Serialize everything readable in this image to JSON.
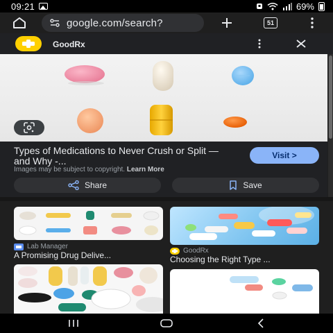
{
  "status_bar": {
    "time": "09:21",
    "battery": "69%"
  },
  "browser": {
    "url": "google.com/search?",
    "tab_count": "51"
  },
  "source": {
    "name": "GoodRx"
  },
  "result": {
    "title": "Types of Medications to Never Crush or Split — and Why -...",
    "copyright_text": "Images may be subject to copyright.",
    "learn_more": "Learn More",
    "visit_label": "Visit >",
    "share_label": "Share",
    "save_label": "Save"
  },
  "related": [
    {
      "source": "Lab Manager",
      "title": "A Promising Drug Delive..."
    },
    {
      "source": "GoodRx",
      "title": "Choosing the Right Type ..."
    }
  ],
  "colors": {
    "accent": "#8ab4f8",
    "brand_goodrx": "#ffd000",
    "background": "#1f1f1f"
  }
}
